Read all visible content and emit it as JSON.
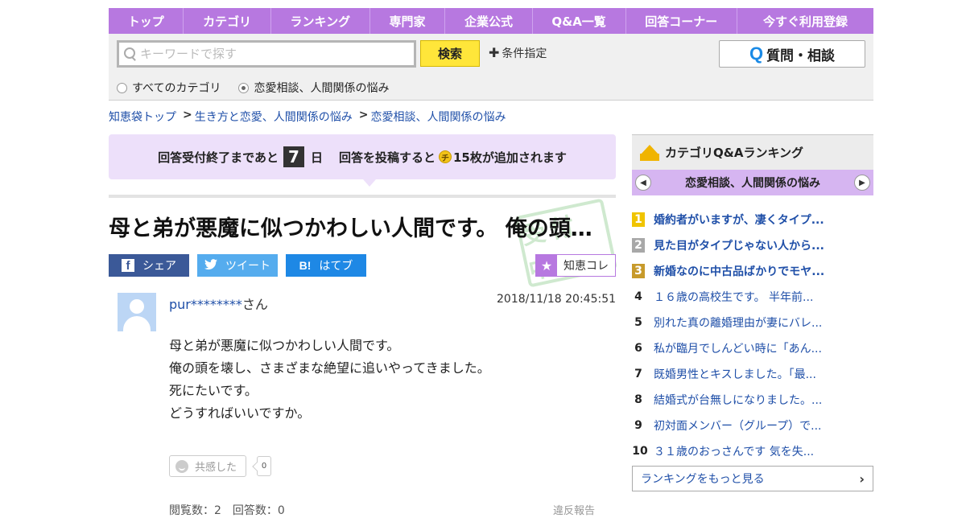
{
  "nav": {
    "items": [
      "トップ",
      "カテゴリ",
      "ランキング",
      "専門家",
      "企業公式",
      "Q&A一覧",
      "回答コーナー",
      "今すぐ利用登録"
    ]
  },
  "search": {
    "placeholder": "キーワードで探す",
    "button_label": "検索",
    "condition_label": "条件指定",
    "ask_button_label": "質問・相談",
    "radio_all_label": "すべてのカテゴリ",
    "radio_category_label": "恋愛相談、人間関係の悩み",
    "selected_radio": "category"
  },
  "breadcrumb": {
    "items": [
      "知恵袋トップ",
      "生き方と恋愛、人間関係の悩み",
      "恋愛相談、人間関係の悩み"
    ],
    "separator": ">"
  },
  "notice": {
    "prefix": "回答受付終了まであと",
    "days": "7",
    "days_unit": "日",
    "middle": "回答を投稿すると",
    "coin_symbol": "チ",
    "suffix": "15枚が追加されます"
  },
  "question": {
    "title": "母と弟が悪魔に似つかわしい人間です。 俺の頭を壊し、さまざまな絶望に追いやってきました。",
    "stamp_text": "受付中",
    "share": {
      "facebook_label": "シェア",
      "twitter_label": "ツイート",
      "hatena_label": "はてブ",
      "hatena_icon_text": "B!"
    },
    "collect_label": "知恵コレ",
    "username": "pur********",
    "username_suffix": "さん",
    "datetime": "2018/11/18  20:45:51",
    "body_lines": [
      "母と弟が悪魔に似つかわしい人間です。",
      "俺の頭を壊し、さまざまな絶望に追いやってきました。",
      "死にたいです。",
      "どうすればいいですか。"
    ],
    "empathy_label": "共感した",
    "empathy_count": "0",
    "stats": "閲覧数：2　回答数：0",
    "report_label": "違反報告"
  },
  "sidebar": {
    "title": "カテゴリQ&Aランキング",
    "category": "恋愛相談、人間関係の悩み",
    "ranking": [
      {
        "rank": "1",
        "text": "婚約者がいますが、凄くタイプ..."
      },
      {
        "rank": "2",
        "text": "見た目がタイプじゃない人から..."
      },
      {
        "rank": "3",
        "text": "新婚なのに中古品ばかりでモヤ..."
      },
      {
        "rank": "4",
        "text": "１６歳の高校生です。 半年前..."
      },
      {
        "rank": "5",
        "text": "別れた真の離婚理由が妻にバレ..."
      },
      {
        "rank": "6",
        "text": "私が臨月でしんどい時に「あん..."
      },
      {
        "rank": "7",
        "text": "既婚男性とキスしました。「最..."
      },
      {
        "rank": "8",
        "text": "結婚式が台無しになりました。..."
      },
      {
        "rank": "9",
        "text": "初対面メンバー（グループ）で..."
      },
      {
        "rank": "10",
        "text": "３１歳のおっさんです 気を失..."
      }
    ],
    "more_label": "ランキングをもっと見る"
  },
  "colors": {
    "nav_purple": "#b778e0",
    "search_yellow": "#ffe63a",
    "link_blue": "#1f4fa8",
    "notice_bg": "#ede0fa"
  }
}
